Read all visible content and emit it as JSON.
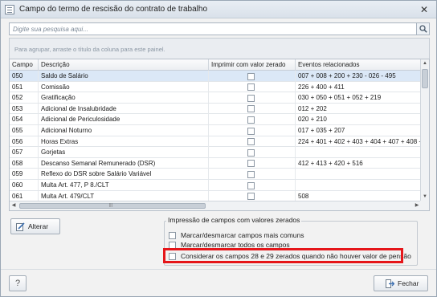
{
  "window": {
    "title": "Campo do termo de rescisão do contrato de trabalho",
    "close_glyph": "✕"
  },
  "search": {
    "value": "",
    "placeholder": "Digite sua pesquisa aqui..."
  },
  "group_panel": {
    "text": "Para agrupar, arraste o título da coluna para este painel."
  },
  "grid": {
    "columns": [
      "Campo",
      "Descrição",
      "Imprimir com valor zerado",
      "Eventos relacionados"
    ],
    "rows": [
      {
        "campo": "050",
        "descricao": "Saldo de Salário",
        "imprimir": false,
        "eventos": "007 + 008 + 200 + 230 - 026 - 495",
        "selected": true
      },
      {
        "campo": "051",
        "descricao": "Comissão",
        "imprimir": false,
        "eventos": "226 + 400 + 411"
      },
      {
        "campo": "052",
        "descricao": "Gratificação",
        "imprimir": false,
        "eventos": "030 + 050 + 051 + 052 + 219"
      },
      {
        "campo": "053",
        "descricao": "Adicional de Insalubridade",
        "imprimir": false,
        "eventos": "012 + 202"
      },
      {
        "campo": "054",
        "descricao": "Adicional de Periculosidade",
        "imprimir": false,
        "eventos": "020 + 210"
      },
      {
        "campo": "055",
        "descricao": "Adicional Noturno",
        "imprimir": false,
        "eventos": "017 + 035 + 207"
      },
      {
        "campo": "056",
        "descricao": "Horas Extras",
        "imprimir": false,
        "eventos": "224 + 401 + 402 + 403 + 404 + 407 + 408 +"
      },
      {
        "campo": "057",
        "descricao": "Gorjetas",
        "imprimir": false,
        "eventos": ""
      },
      {
        "campo": "058",
        "descricao": "Descanso Semanal Remunerado (DSR)",
        "imprimir": false,
        "eventos": "412 + 413 + 420 + 516"
      },
      {
        "campo": "059",
        "descricao": "Reflexo do DSR sobre Salário Variável",
        "imprimir": false,
        "eventos": ""
      },
      {
        "campo": "060",
        "descricao": "Multa Art. 477, P 8./CLT",
        "imprimir": false,
        "eventos": ""
      },
      {
        "campo": "061",
        "descricao": "Multa Art. 479/CLT",
        "imprimir": false,
        "eventos": "508"
      }
    ]
  },
  "buttons": {
    "alterar": "Alterar",
    "fechar": "Fechar",
    "help": "?"
  },
  "options_group": {
    "legend": "Impressão de campos com valores zerados",
    "options": [
      {
        "label": "Marcar/desmarcar campos mais comuns",
        "checked": false
      },
      {
        "label": "Marcar/desmarcar todos os campos",
        "checked": false
      },
      {
        "label": "Considerar os campos 28 e 29 zerados quando não houver valor de pensão",
        "checked": false
      }
    ]
  },
  "colors": {
    "highlight": "#e5161a",
    "selected_row": "#dbe8f7"
  }
}
